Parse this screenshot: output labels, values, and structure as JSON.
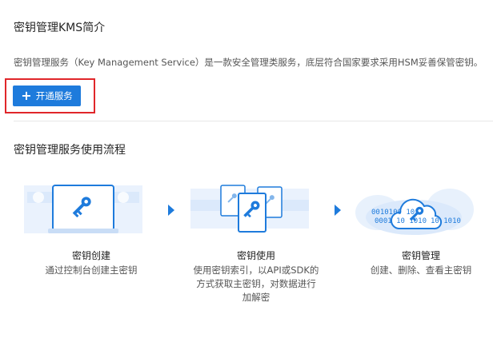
{
  "intro": {
    "title": "密钥管理KMS简介",
    "description": "密钥管理服务（Key Management Service）是一款安全管理类服务，底层符合国家要求采用HSM妥善保管密钥。",
    "open_button_label": "开通服务",
    "open_button_icon": "plus-icon"
  },
  "flow": {
    "title": "密钥管理服务使用流程",
    "steps": [
      {
        "name": "密钥创建",
        "desc_lines": [
          "通过控制台创建主密钥"
        ],
        "icon": "key-monitor-icon"
      },
      {
        "name": "密钥使用",
        "desc_lines": [
          "使用密钥索引，以API或SDK的",
          "方式获取主密钥，对数据进行",
          "加解密"
        ],
        "icon": "key-documents-icon"
      },
      {
        "name": "密钥管理",
        "desc_lines": [
          "创建、删除、查看主密钥"
        ],
        "icon": "key-cloud-icon"
      }
    ],
    "cloud_binary_text": [
      "0010100 10",
      "0001 10 1010",
      "10 1010"
    ]
  },
  "colors": {
    "accent": "#1e7bdc",
    "highlight_border": "#e0262a",
    "illustration_light": "#dbe9fb"
  }
}
